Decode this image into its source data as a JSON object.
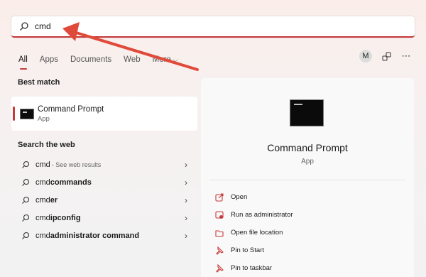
{
  "search": {
    "value": "cmd"
  },
  "tabs": [
    {
      "label": "All"
    },
    {
      "label": "Apps"
    },
    {
      "label": "Documents"
    },
    {
      "label": "Web"
    },
    {
      "label": "More"
    }
  ],
  "header_right": {
    "avatar_letter": "M"
  },
  "best_match": {
    "title": "Best match",
    "name": "Command Prompt",
    "type": "App"
  },
  "search_web": {
    "title": "Search the web",
    "items": [
      {
        "prefix": "cmd",
        "bold": "",
        "suffix": " - See web results"
      },
      {
        "prefix": "cmd ",
        "bold": "commands",
        "suffix": ""
      },
      {
        "prefix": "cmd",
        "bold": "er",
        "suffix": ""
      },
      {
        "prefix": "cmd ",
        "bold": "ipconfig",
        "suffix": ""
      },
      {
        "prefix": "cmd ",
        "bold": "administrator command",
        "suffix": ""
      }
    ]
  },
  "details": {
    "name": "Command Prompt",
    "type": "App",
    "actions": [
      {
        "label": "Open"
      },
      {
        "label": "Run as administrator"
      },
      {
        "label": "Open file location"
      },
      {
        "label": "Pin to Start"
      },
      {
        "label": "Pin to taskbar"
      }
    ]
  },
  "colors": {
    "accent": "#c63a3a",
    "annotation_arrow": "#e04a3a"
  }
}
